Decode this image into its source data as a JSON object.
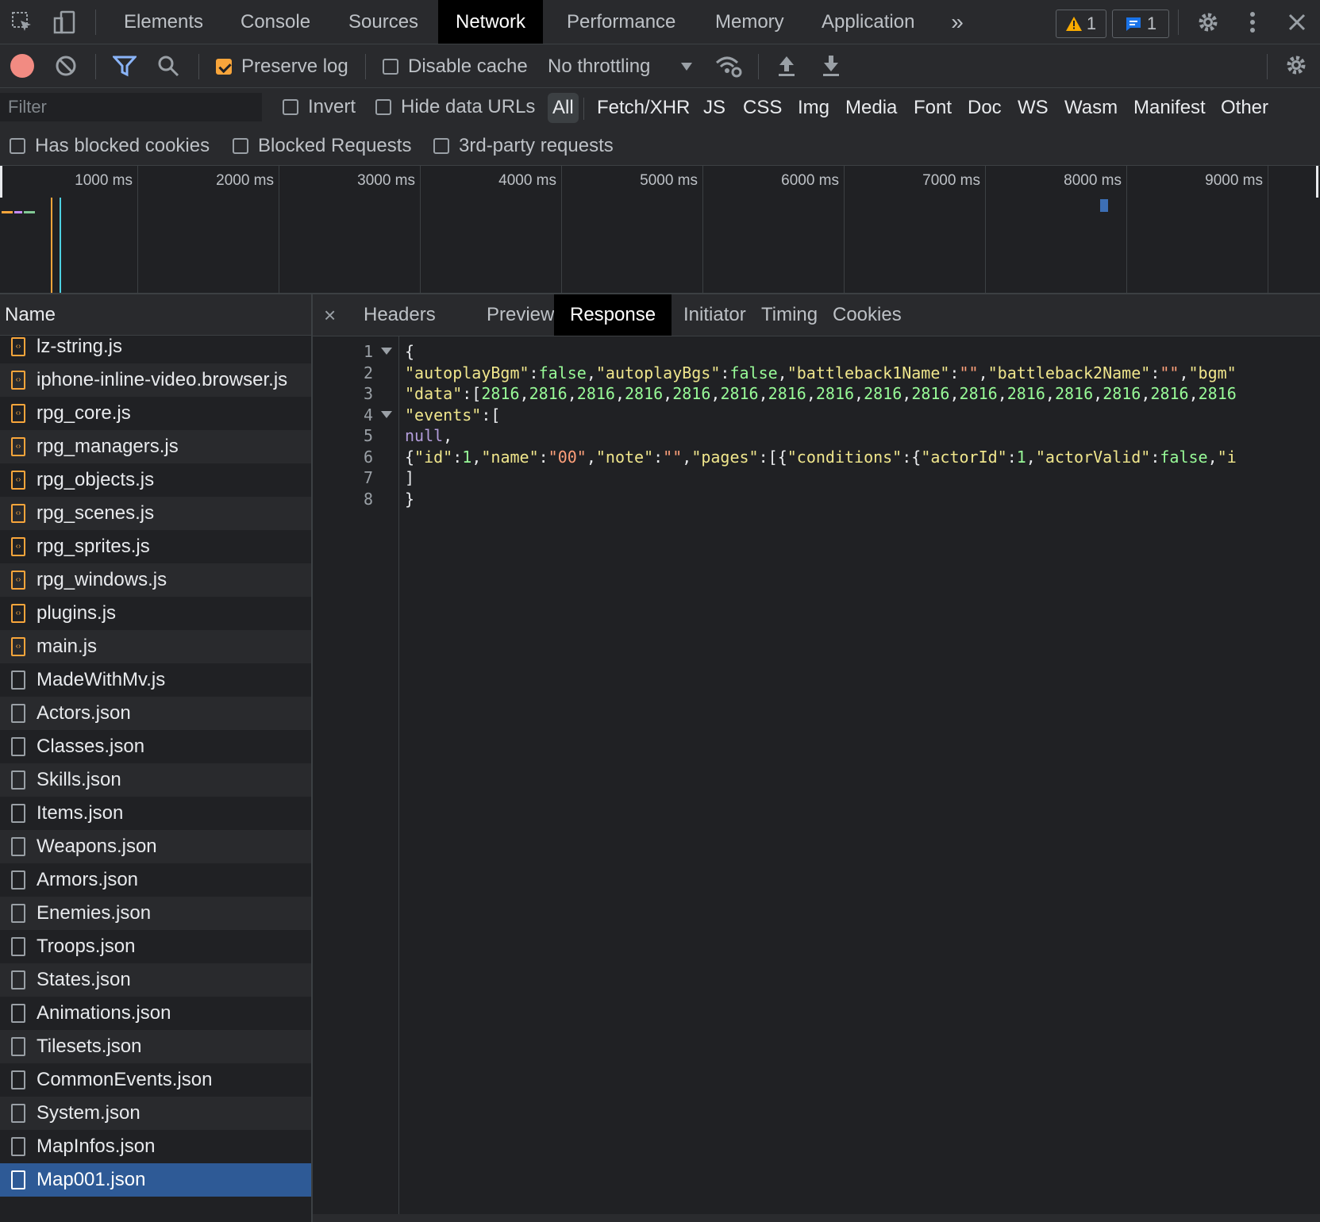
{
  "tabs": {
    "items": [
      "Elements",
      "Console",
      "Sources",
      "Network",
      "Performance",
      "Memory",
      "Application"
    ],
    "active": "Network",
    "more": "»",
    "warning_count": "1",
    "message_count": "1"
  },
  "toolbar": {
    "preserve_log": "Preserve log",
    "disable_cache": "Disable cache",
    "throttling": "No throttling"
  },
  "filter": {
    "placeholder": "Filter",
    "invert": "Invert",
    "hide_data_urls": "Hide data URLs",
    "types": [
      "All",
      "Fetch/XHR",
      "JS",
      "CSS",
      "Img",
      "Media",
      "Font",
      "Doc",
      "WS",
      "Wasm",
      "Manifest",
      "Other"
    ],
    "active_type": "All",
    "has_blocked_cookies": "Has blocked cookies",
    "blocked_requests": "Blocked Requests",
    "third_party": "3rd-party requests"
  },
  "timeline": {
    "ticks": [
      "1000 ms",
      "2000 ms",
      "3000 ms",
      "4000 ms",
      "5000 ms",
      "6000 ms",
      "7000 ms",
      "8000 ms",
      "9000 ms"
    ]
  },
  "requests": {
    "header": "Name",
    "items": [
      {
        "name": "lz-string.js",
        "type": "js"
      },
      {
        "name": "iphone-inline-video.browser.js",
        "type": "js"
      },
      {
        "name": "rpg_core.js",
        "type": "js"
      },
      {
        "name": "rpg_managers.js",
        "type": "js"
      },
      {
        "name": "rpg_objects.js",
        "type": "js"
      },
      {
        "name": "rpg_scenes.js",
        "type": "js"
      },
      {
        "name": "rpg_sprites.js",
        "type": "js"
      },
      {
        "name": "rpg_windows.js",
        "type": "js"
      },
      {
        "name": "plugins.js",
        "type": "js"
      },
      {
        "name": "main.js",
        "type": "js"
      },
      {
        "name": "MadeWithMv.js",
        "type": "doc"
      },
      {
        "name": "Actors.json",
        "type": "doc"
      },
      {
        "name": "Classes.json",
        "type": "doc"
      },
      {
        "name": "Skills.json",
        "type": "doc"
      },
      {
        "name": "Items.json",
        "type": "doc"
      },
      {
        "name": "Weapons.json",
        "type": "doc"
      },
      {
        "name": "Armors.json",
        "type": "doc"
      },
      {
        "name": "Enemies.json",
        "type": "doc"
      },
      {
        "name": "Troops.json",
        "type": "doc"
      },
      {
        "name": "States.json",
        "type": "doc"
      },
      {
        "name": "Animations.json",
        "type": "doc"
      },
      {
        "name": "Tilesets.json",
        "type": "doc"
      },
      {
        "name": "CommonEvents.json",
        "type": "doc"
      },
      {
        "name": "System.json",
        "type": "doc"
      },
      {
        "name": "MapInfos.json",
        "type": "doc"
      },
      {
        "name": "Map001.json",
        "type": "doc"
      }
    ],
    "selected": "Map001.json"
  },
  "detail": {
    "close": "×",
    "tabs": [
      "Headers",
      "Preview",
      "Response",
      "Initiator",
      "Timing",
      "Cookies"
    ],
    "active": "Response",
    "line_numbers": [
      "1",
      "2",
      "3",
      "4",
      "5",
      "6",
      "7",
      "8"
    ],
    "lines": [
      [
        {
          "t": "{",
          "c": "p"
        }
      ],
      [
        {
          "t": "\"autoplayBgm\"",
          "c": "k"
        },
        {
          "t": ":",
          "c": "p"
        },
        {
          "t": "false",
          "c": "b"
        },
        {
          "t": ",",
          "c": "p"
        },
        {
          "t": "\"autoplayBgs\"",
          "c": "k"
        },
        {
          "t": ":",
          "c": "p"
        },
        {
          "t": "false",
          "c": "b"
        },
        {
          "t": ",",
          "c": "p"
        },
        {
          "t": "\"battleback1Name\"",
          "c": "k"
        },
        {
          "t": ":",
          "c": "p"
        },
        {
          "t": "\"\"",
          "c": "sv"
        },
        {
          "t": ",",
          "c": "p"
        },
        {
          "t": "\"battleback2Name\"",
          "c": "k"
        },
        {
          "t": ":",
          "c": "p"
        },
        {
          "t": "\"\"",
          "c": "sv"
        },
        {
          "t": ",",
          "c": "p"
        },
        {
          "t": "\"bgm\"",
          "c": "k"
        }
      ],
      [
        {
          "t": "\"data\"",
          "c": "k"
        },
        {
          "t": ":[",
          "c": "p"
        },
        {
          "t": "2816",
          "c": "n"
        },
        {
          "t": ",",
          "c": "p"
        },
        {
          "t": "2816",
          "c": "n"
        },
        {
          "t": ",",
          "c": "p"
        },
        {
          "t": "2816",
          "c": "n"
        },
        {
          "t": ",",
          "c": "p"
        },
        {
          "t": "2816",
          "c": "n"
        },
        {
          "t": ",",
          "c": "p"
        },
        {
          "t": "2816",
          "c": "n"
        },
        {
          "t": ",",
          "c": "p"
        },
        {
          "t": "2816",
          "c": "n"
        },
        {
          "t": ",",
          "c": "p"
        },
        {
          "t": "2816",
          "c": "n"
        },
        {
          "t": ",",
          "c": "p"
        },
        {
          "t": "2816",
          "c": "n"
        },
        {
          "t": ",",
          "c": "p"
        },
        {
          "t": "2816",
          "c": "n"
        },
        {
          "t": ",",
          "c": "p"
        },
        {
          "t": "2816",
          "c": "n"
        },
        {
          "t": ",",
          "c": "p"
        },
        {
          "t": "2816",
          "c": "n"
        },
        {
          "t": ",",
          "c": "p"
        },
        {
          "t": "2816",
          "c": "n"
        },
        {
          "t": ",",
          "c": "p"
        },
        {
          "t": "2816",
          "c": "n"
        },
        {
          "t": ",",
          "c": "p"
        },
        {
          "t": "2816",
          "c": "n"
        },
        {
          "t": ",",
          "c": "p"
        },
        {
          "t": "2816",
          "c": "n"
        },
        {
          "t": ",",
          "c": "p"
        },
        {
          "t": "2816",
          "c": "n"
        }
      ],
      [
        {
          "t": "\"events\"",
          "c": "k"
        },
        {
          "t": ":[",
          "c": "p"
        }
      ],
      [
        {
          "t": "null",
          "c": "nl"
        },
        {
          "t": ",",
          "c": "p"
        }
      ],
      [
        {
          "t": "{",
          "c": "p"
        },
        {
          "t": "\"id\"",
          "c": "k"
        },
        {
          "t": ":",
          "c": "p"
        },
        {
          "t": "1",
          "c": "n"
        },
        {
          "t": ",",
          "c": "p"
        },
        {
          "t": "\"name\"",
          "c": "k"
        },
        {
          "t": ":",
          "c": "p"
        },
        {
          "t": "\"00\"",
          "c": "sv"
        },
        {
          "t": ",",
          "c": "p"
        },
        {
          "t": "\"note\"",
          "c": "k"
        },
        {
          "t": ":",
          "c": "p"
        },
        {
          "t": "\"\"",
          "c": "sv"
        },
        {
          "t": ",",
          "c": "p"
        },
        {
          "t": "\"pages\"",
          "c": "k"
        },
        {
          "t": ":[{",
          "c": "p"
        },
        {
          "t": "\"conditions\"",
          "c": "k"
        },
        {
          "t": ":{",
          "c": "p"
        },
        {
          "t": "\"actorId\"",
          "c": "k"
        },
        {
          "t": ":",
          "c": "p"
        },
        {
          "t": "1",
          "c": "n"
        },
        {
          "t": ",",
          "c": "p"
        },
        {
          "t": "\"actorValid\"",
          "c": "k"
        },
        {
          "t": ":",
          "c": "p"
        },
        {
          "t": "false",
          "c": "b"
        },
        {
          "t": ",",
          "c": "p"
        },
        {
          "t": "\"i",
          "c": "k"
        }
      ],
      [
        {
          "t": "]",
          "c": "p"
        }
      ],
      [
        {
          "t": "}",
          "c": "p"
        }
      ]
    ],
    "foldable_lines": [
      "1",
      "4"
    ]
  },
  "colors": {
    "accent_orange": "#f8a53b",
    "selected_row": "#2e5a96",
    "record_red": "#f28b82"
  }
}
